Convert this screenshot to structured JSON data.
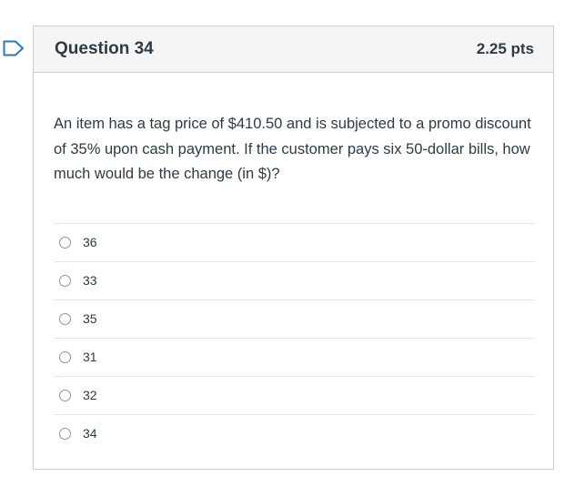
{
  "question": {
    "title": "Question 34",
    "points": "2.25 pts",
    "flag_icon": "flag-outline-icon",
    "prompt": "An item has a tag price of $410.50 and is subjected to a promo discount of 35% upon cash payment. If the customer pays six 50-dollar bills, how much would be the change (in $)?",
    "answers": [
      {
        "label": "36",
        "selected": false
      },
      {
        "label": "33",
        "selected": false
      },
      {
        "label": "35",
        "selected": false
      },
      {
        "label": "31",
        "selected": false
      },
      {
        "label": "32",
        "selected": false
      },
      {
        "label": "34",
        "selected": false
      }
    ]
  },
  "colors": {
    "flag": "#2b7abc",
    "border": "#c7cdd1",
    "header_bg": "#f5f5f5",
    "text": "#2d3b45"
  }
}
